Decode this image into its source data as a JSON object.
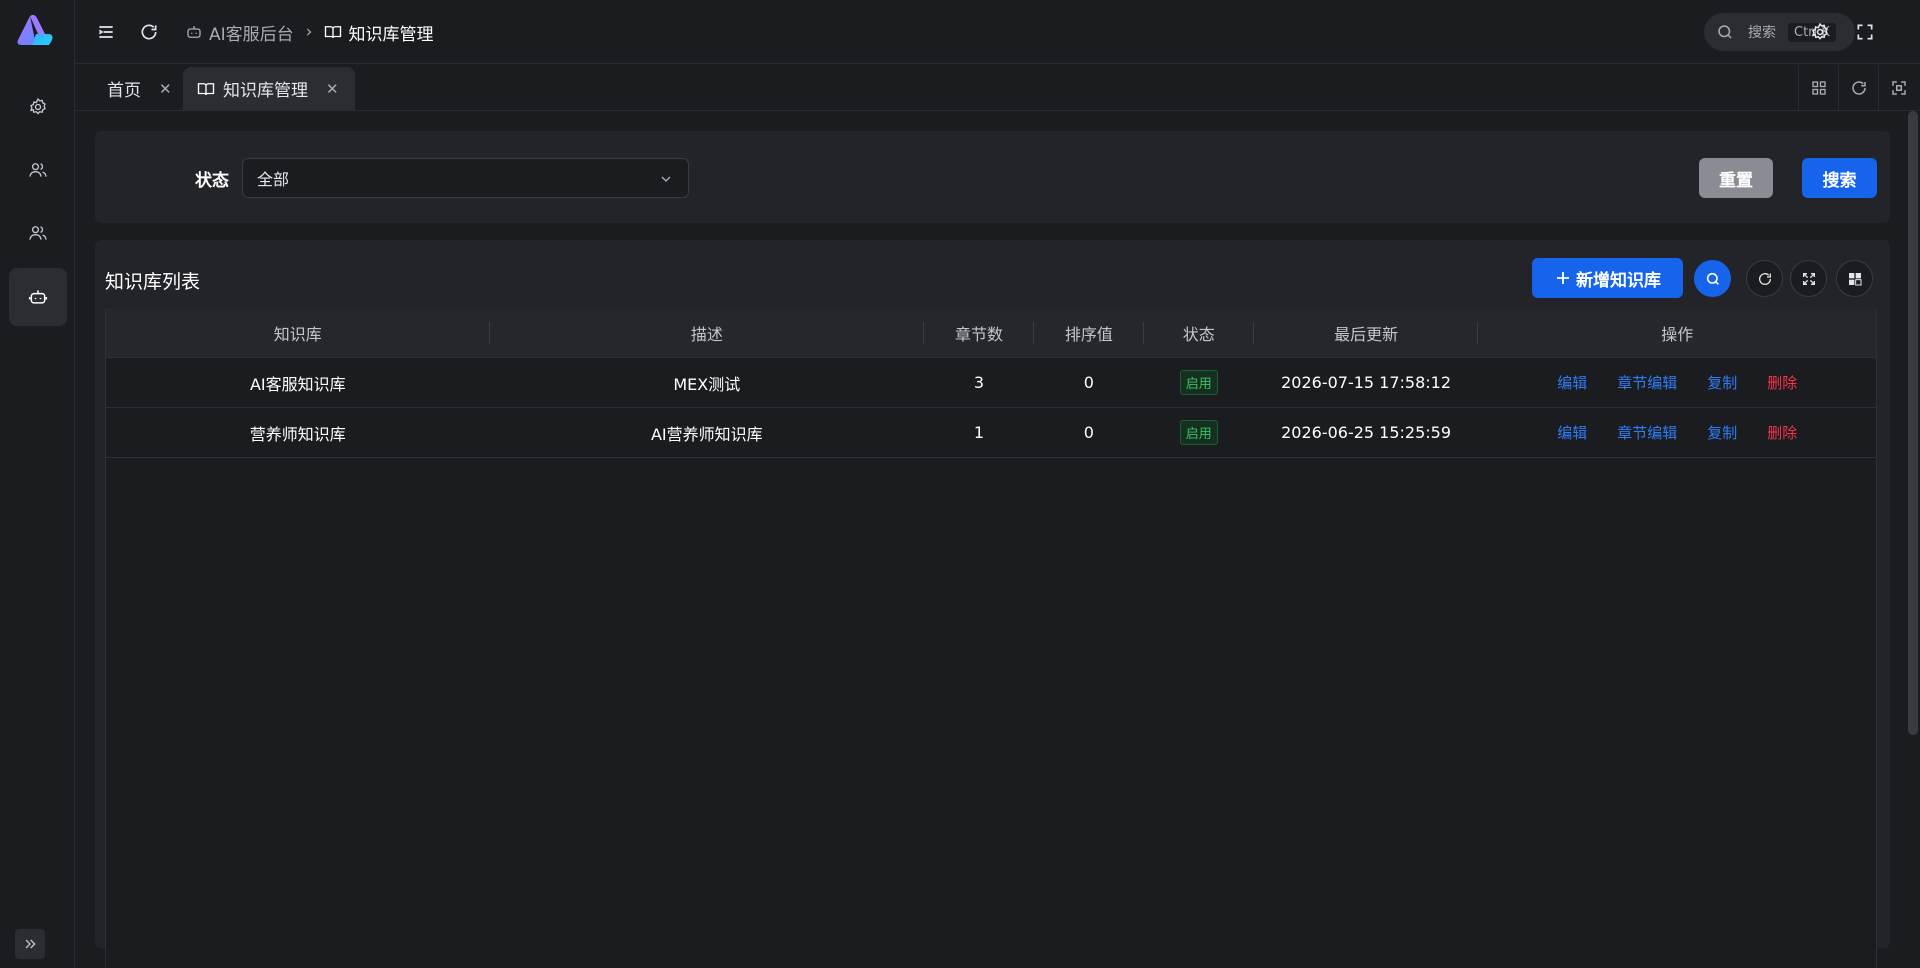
{
  "header": {
    "breadcrumb": [
      {
        "label": "AI客服后台",
        "icon": "robot-icon"
      },
      {
        "label": "知识库管理",
        "icon": "book-icon"
      }
    ],
    "search_placeholder": "搜索",
    "search_shortcut": "Ctrl K"
  },
  "sidebar": {
    "items": [
      {
        "icon": "gear-icon",
        "active": false
      },
      {
        "icon": "users-icon",
        "active": false
      },
      {
        "icon": "users-icon",
        "active": false
      },
      {
        "icon": "robot-icon",
        "active": true
      }
    ]
  },
  "tabs": [
    {
      "label": "首页",
      "active": false
    },
    {
      "label": "知识库管理",
      "active": true,
      "icon": "book-icon"
    }
  ],
  "filter": {
    "status_label": "状态",
    "status_value": "全部",
    "reset_label": "重置",
    "search_label": "搜索"
  },
  "table_card": {
    "title": "知识库列表",
    "add_label": "新增知识库",
    "columns": [
      "知识库",
      "描述",
      "章节数",
      "排序值",
      "状态",
      "最后更新",
      "操作"
    ],
    "rows": [
      {
        "name": "AI客服知识库",
        "desc": "MEX测试",
        "chapters": "3",
        "sort": "0",
        "status": "启用",
        "updated": "2026-07-15 17:58:12"
      },
      {
        "name": "营养师知识库",
        "desc": "AI营养师知识库",
        "chapters": "1",
        "sort": "0",
        "status": "启用",
        "updated": "2026-06-25 15:25:59"
      }
    ],
    "actions": {
      "edit": "编辑",
      "chapter_edit": "章节编辑",
      "copy": "复制",
      "delete": "删除"
    }
  },
  "colors": {
    "primary": "#1764ec",
    "danger": "#f5334b",
    "success": "#3ec26a",
    "background": "#1b1c20",
    "card": "#232429"
  }
}
